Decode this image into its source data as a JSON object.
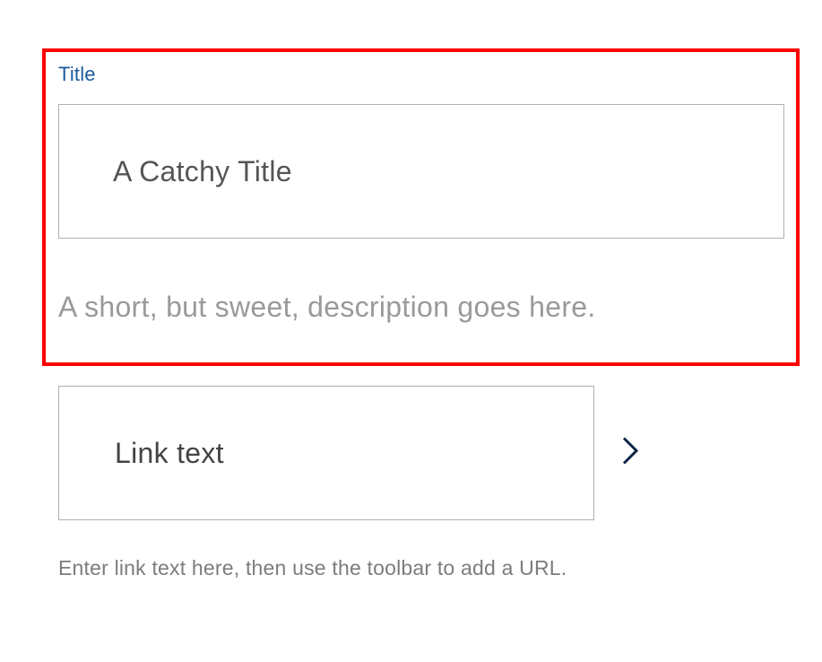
{
  "title_section": {
    "label": "Title",
    "placeholder": "A Catchy Title",
    "description": "A short, but sweet, description goes here."
  },
  "link_section": {
    "link_text": "Link text",
    "helper": "Enter link text here, then use the toolbar to add a URL."
  }
}
